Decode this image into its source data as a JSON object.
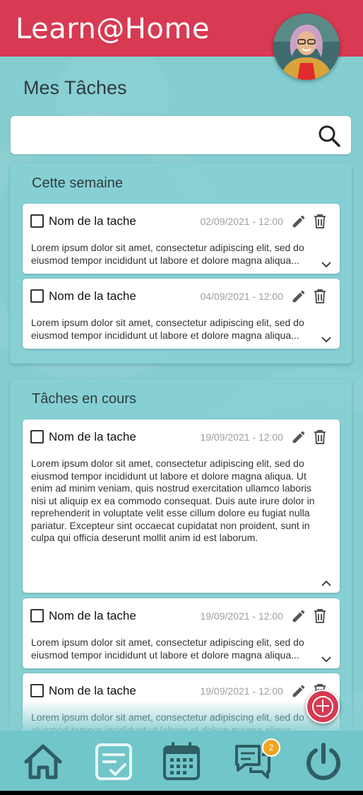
{
  "app": {
    "title": "Learn@Home"
  },
  "page": {
    "title": "Mes Tâches"
  },
  "search": {
    "placeholder": ""
  },
  "sections": [
    {
      "title": "Cette semaine",
      "tasks": [
        {
          "name": "Nom de la tache",
          "datetime": "02/09/2021 - 12:00",
          "description": "Lorem ipsum dolor sit amet, consectetur adipiscing elit, sed do eiusmod tempor incididunt ut labore et dolore magna aliqua...",
          "expanded": false
        },
        {
          "name": "Nom de la tache",
          "datetime": "04/09/2021 - 12:00",
          "description": "Lorem ipsum dolor sit amet, consectetur adipiscing elit, sed do eiusmod tempor incididunt ut labore et dolore magna aliqua...",
          "expanded": false
        }
      ]
    },
    {
      "title": "Tâches en cours",
      "tasks": [
        {
          "name": "Nom de la tache",
          "datetime": "19/09/2021 - 12:00",
          "description": "Lorem ipsum dolor sit amet, consectetur adipiscing elit, sed do eiusmod tempor incididunt ut labore et dolore magna aliqua. Ut enim ad minim veniam, quis nostrud exercitation ullamco laboris nisi ut aliquip ex ea commodo consequat. Duis aute irure dolor in reprehenderit in voluptate velit esse cillum dolore eu fugiat nulla pariatur. Excepteur sint occaecat cupidatat non proident, sunt in culpa qui officia deserunt mollit anim id est laborum.",
          "expanded": true
        },
        {
          "name": "Nom de la tache",
          "datetime": "19/09/2021 - 12:00",
          "description": "Lorem ipsum dolor sit amet, consectetur adipiscing elit, sed do eiusmod tempor incididunt ut labore et dolore magna aliqua...",
          "expanded": false
        },
        {
          "name": "Nom de la tache",
          "datetime": "19/09/2021 - 12:00",
          "description": "Lorem ipsum dolor sit amet, consectetur adipiscing elit, sed do eiusmod tempor incididunt ut labore et dolore magna aliqua...",
          "expanded": false
        }
      ]
    }
  ],
  "nav": {
    "items": [
      {
        "icon": "home-icon"
      },
      {
        "icon": "tasks-icon",
        "active": true
      },
      {
        "icon": "calendar-icon"
      },
      {
        "icon": "chat-icon",
        "badge": "2"
      },
      {
        "icon": "power-icon"
      }
    ]
  },
  "colors": {
    "header": "#d73a52",
    "background": "#84cdd1",
    "nav": "#71c6ca",
    "badge": "#f2a51f",
    "icon": "#2f5d63"
  }
}
